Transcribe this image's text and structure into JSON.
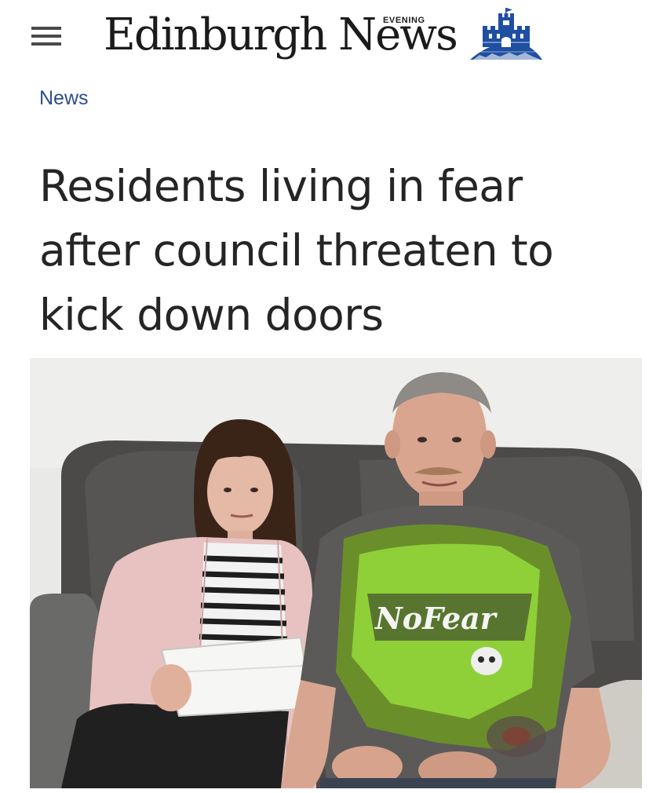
{
  "header": {
    "menu_icon": "hamburger-menu-icon",
    "logo_main": "Edinburgh News",
    "logo_small": "EVENING",
    "logo_emblem_icon": "castle-emblem-icon"
  },
  "section": {
    "label": "News"
  },
  "article": {
    "headline": "Residents living in fear after council threaten to kick down doors"
  },
  "shirt_print": "NoFear",
  "colors": {
    "section_link": "#2c4d8f",
    "headline": "#252525",
    "logo": "#1b1b1b",
    "emblem_blue": "#1f4fa0"
  }
}
